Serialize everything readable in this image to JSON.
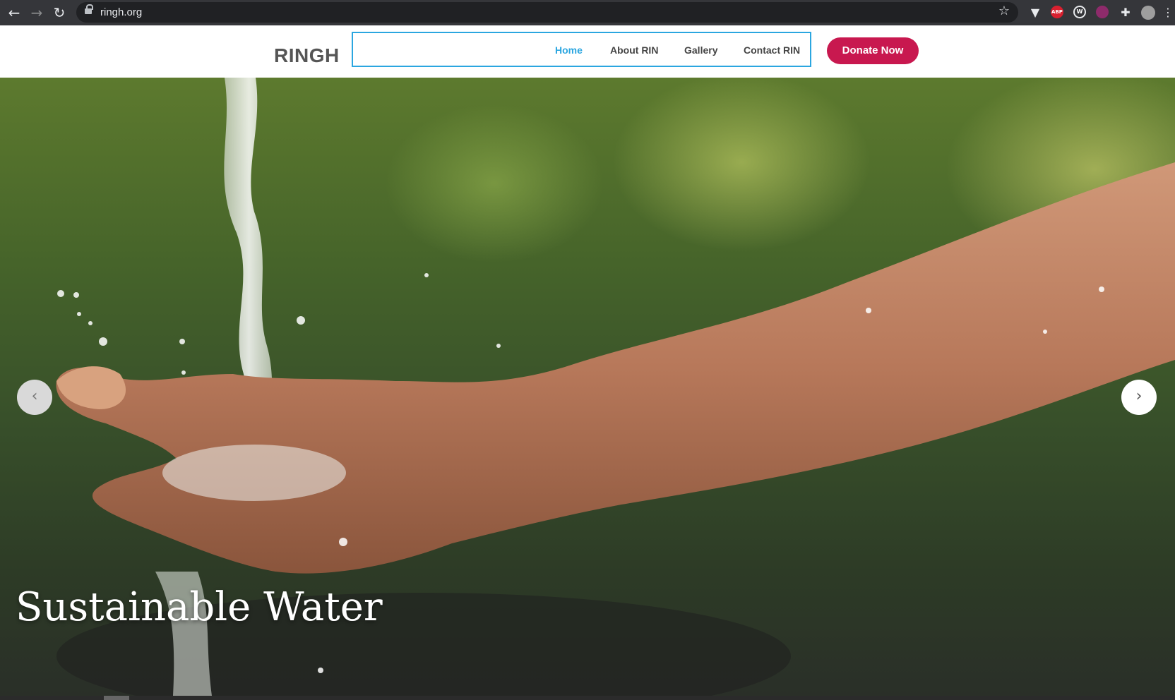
{
  "browser": {
    "url": "ringh.org",
    "icons": {
      "back": "arrow-left",
      "forward": "arrow-right",
      "reload": "reload",
      "lock": "lock",
      "bookmark": "star",
      "extensions": [
        "vivaldi-v",
        "adblock-plus",
        "w-circle",
        "puzzle",
        "profile-avatar"
      ]
    },
    "extension_labels": {
      "abp": "ABP",
      "w": "W"
    }
  },
  "header": {
    "logo": "RINGH",
    "nav": [
      {
        "label": "Home",
        "active": true
      },
      {
        "label": "About RIN",
        "active": false
      },
      {
        "label": "Gallery",
        "active": false
      },
      {
        "label": "Contact RIN",
        "active": false
      }
    ],
    "donate_label": "Donate Now"
  },
  "hero": {
    "caption": "Sustainable Water",
    "prev_icon": "chevron-left",
    "next_icon": "chevron-right"
  },
  "colors": {
    "accent": "#2ba6e0",
    "donate": "#c8184f",
    "logo": "#555555"
  }
}
